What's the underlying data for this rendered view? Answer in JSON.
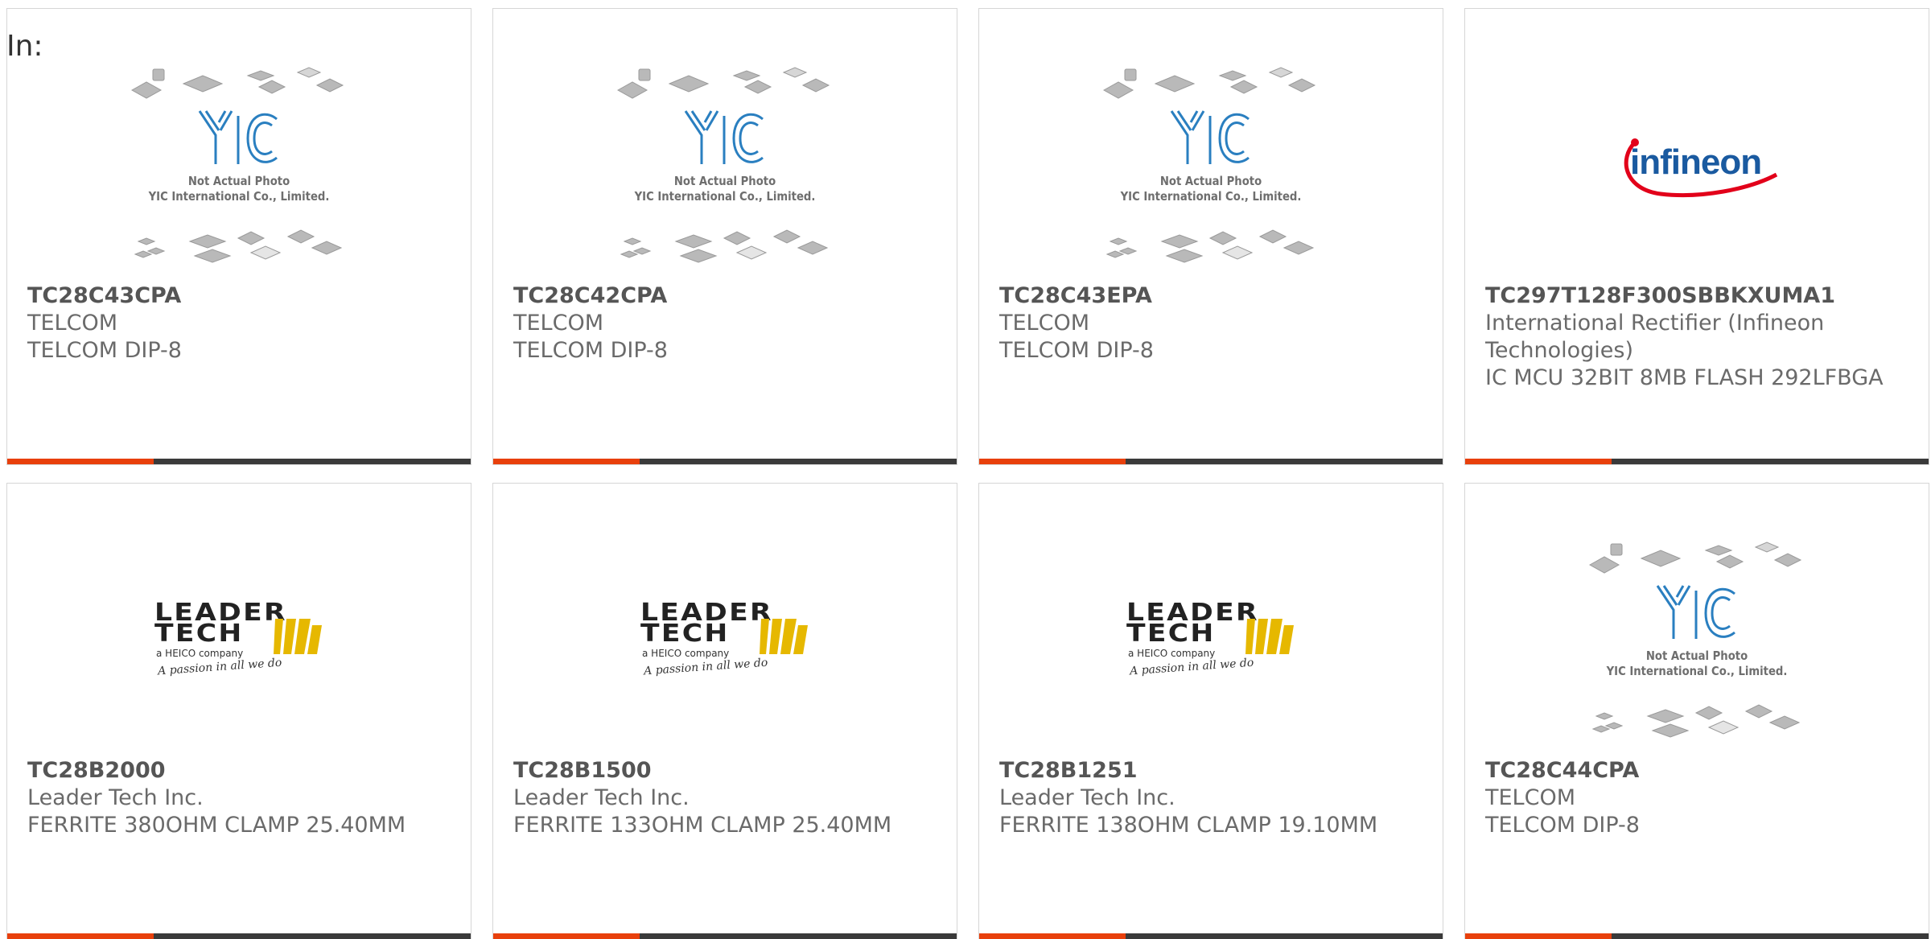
{
  "header": {
    "label": "In:"
  },
  "placeholder": {
    "line1": "Not Actual Photo",
    "line2": "YIC International Co., Limited."
  },
  "logos": {
    "infineon": "infineon",
    "leader_tech_line1": "LEADER",
    "leader_tech_line2": "TECH",
    "leader_tech_sub": "a HEICO company",
    "leader_tech_tag": "A passion in all we do"
  },
  "colors": {
    "accent": "#e8400c",
    "bar": "#3a3a3a",
    "text": "#6a6a6a"
  },
  "products": [
    {
      "part": "TC28C43CPA",
      "manufacturer": "TELCOM",
      "description": "TELCOM DIP-8",
      "image": "yic-placeholder"
    },
    {
      "part": "TC28C42CPA",
      "manufacturer": "TELCOM",
      "description": "TELCOM DIP-8",
      "image": "yic-placeholder"
    },
    {
      "part": "TC28C43EPA",
      "manufacturer": "TELCOM",
      "description": "TELCOM DIP-8",
      "image": "yic-placeholder"
    },
    {
      "part": "TC297T128F300SBBKXUMA1",
      "manufacturer": "International Rectifier (Infineon Technologies)",
      "description": "IC MCU 32BIT 8MB FLASH 292LFBGA",
      "image": "infineon-logo"
    },
    {
      "part": "TC28B2000",
      "manufacturer": "Leader Tech Inc.",
      "description": "FERRITE 380OHM CLAMP 25.40MM",
      "image": "leader-tech-logo"
    },
    {
      "part": "TC28B1500",
      "manufacturer": "Leader Tech Inc.",
      "description": "FERRITE 133OHM CLAMP 25.40MM",
      "image": "leader-tech-logo"
    },
    {
      "part": "TC28B1251",
      "manufacturer": "Leader Tech Inc.",
      "description": "FERRITE 138OHM CLAMP 19.10MM",
      "image": "leader-tech-logo"
    },
    {
      "part": "TC28C44CPA",
      "manufacturer": "TELCOM",
      "description": "TELCOM DIP-8",
      "image": "yic-placeholder"
    }
  ]
}
